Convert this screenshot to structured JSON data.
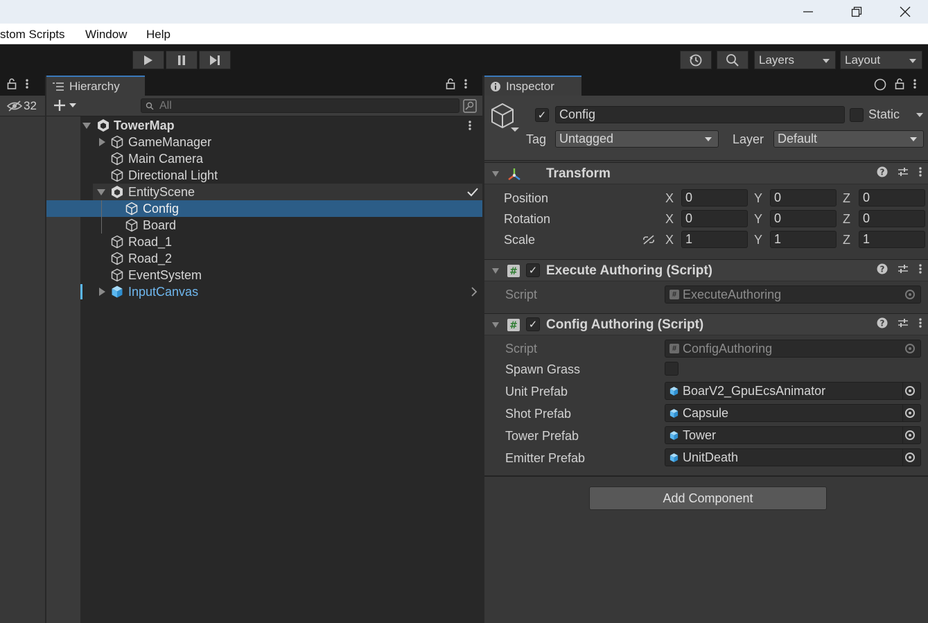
{
  "menu": {
    "items": [
      "stom Scripts",
      "Window",
      "Help"
    ]
  },
  "toolbar": {
    "layers_label": "Layers",
    "layout_label": "Layout"
  },
  "left_strip": {
    "hidden_count": "32"
  },
  "hierarchy": {
    "tab_label": "Hierarchy",
    "search_placeholder": "All",
    "rows": [
      {
        "label": "TowerMap"
      },
      {
        "label": "GameManager"
      },
      {
        "label": "Main Camera"
      },
      {
        "label": "Directional Light"
      },
      {
        "label": "EntityScene"
      },
      {
        "label": "Config"
      },
      {
        "label": "Board"
      },
      {
        "label": "Road_1"
      },
      {
        "label": "Road_2"
      },
      {
        "label": "EventSystem"
      },
      {
        "label": "InputCanvas"
      }
    ]
  },
  "inspector": {
    "tab_label": "Inspector",
    "object_name": "Config",
    "static_label": "Static",
    "tag_label": "Tag",
    "tag_value": "Untagged",
    "layer_label": "Layer",
    "layer_value": "Default",
    "transform": {
      "title": "Transform",
      "position_label": "Position",
      "rotation_label": "Rotation",
      "scale_label": "Scale",
      "axis_x": "X",
      "axis_y": "Y",
      "axis_z": "Z",
      "position": [
        "0",
        "0",
        "0"
      ],
      "rotation": [
        "0",
        "0",
        "0"
      ],
      "scale": [
        "1",
        "1",
        "1"
      ]
    },
    "execute_authoring": {
      "title": "Execute Authoring (Script)",
      "script_label": "Script",
      "script_value": "ExecuteAuthoring"
    },
    "config_authoring": {
      "title": "Config Authoring (Script)",
      "script_label": "Script",
      "script_value": "ConfigAuthoring",
      "spawn_grass_label": "Spawn Grass",
      "unit_prefab_label": "Unit Prefab",
      "unit_prefab_value": "BoarV2_GpuEcsAnimator",
      "shot_prefab_label": "Shot Prefab",
      "shot_prefab_value": "Capsule",
      "tower_prefab_label": "Tower Prefab",
      "tower_prefab_value": "Tower",
      "emitter_prefab_label": "Emitter Prefab",
      "emitter_prefab_value": "UnitDeath"
    },
    "add_component_label": "Add Component"
  },
  "colors": {
    "selection": "#2c5d87",
    "prefab_blue": "#5bb7f0",
    "tab_accent": "#3a79bb"
  }
}
